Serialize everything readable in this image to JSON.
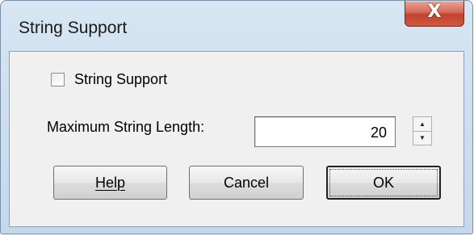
{
  "window": {
    "title": "String Support",
    "close_label": "X"
  },
  "form": {
    "string_support_label": "String Support",
    "string_support_checked": false,
    "max_length_label": "Maximum String Length:",
    "max_length_value": "20"
  },
  "buttons": {
    "help": "Help",
    "cancel": "Cancel",
    "ok": "OK"
  }
}
